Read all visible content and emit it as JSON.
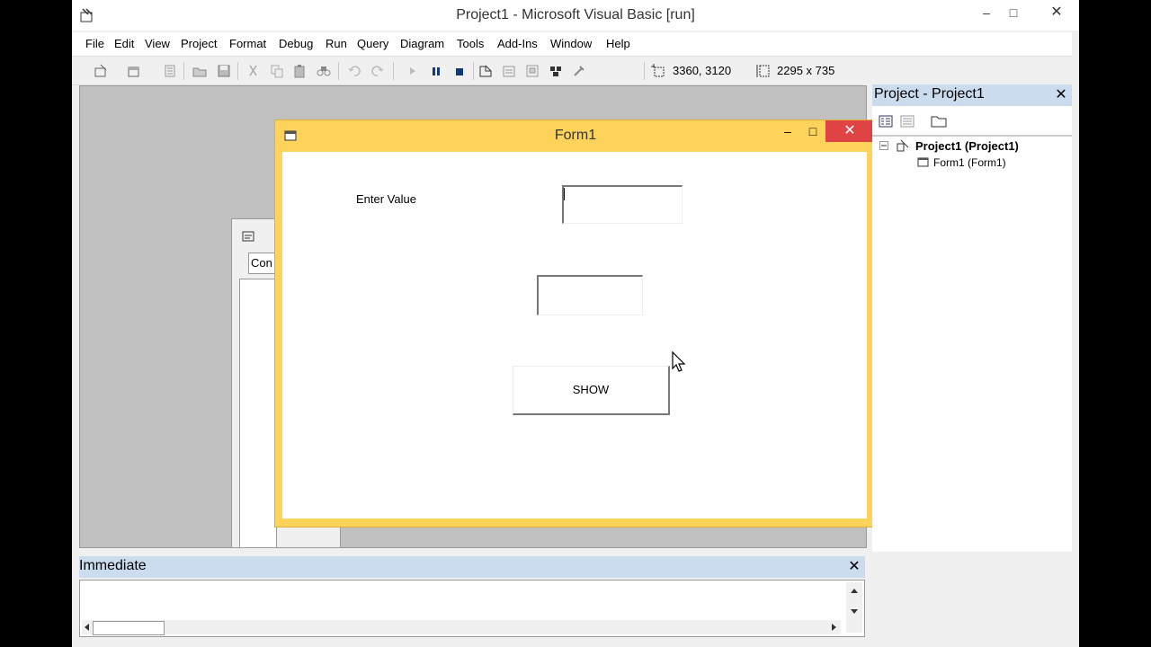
{
  "window": {
    "title": "Project1 - Microsoft Visual Basic [run]",
    "minimize_glyph": "–",
    "maximize_glyph": "□",
    "close_glyph": "✕"
  },
  "menu": [
    "File",
    "Edit",
    "View",
    "Project",
    "Format",
    "Debug",
    "Run",
    "Query",
    "Diagram",
    "Tools",
    "Add-Ins",
    "Window",
    "Help"
  ],
  "toolbar": {
    "position_readout": "3360, 3120",
    "size_readout": "2295 x 735",
    "icons": [
      "add-project-icon",
      "add-form-icon",
      "menu-editor-icon",
      "open-icon",
      "save-icon",
      "cut-icon",
      "copy-icon",
      "paste-icon",
      "find-icon",
      "undo-icon",
      "redo-icon",
      "start-icon",
      "break-icon",
      "end-icon",
      "project-explorer-icon",
      "properties-icon",
      "form-layout-icon",
      "object-browser-icon",
      "toolbox-icon"
    ]
  },
  "code_window": {
    "combo_text": "Con"
  },
  "form1": {
    "title": "Form1",
    "label": "Enter Value",
    "text1_value": "",
    "text2_value": "",
    "button_label": "SHOW",
    "minimize_glyph": "–",
    "maximize_glyph": "□",
    "close_glyph": "✕"
  },
  "project_panel": {
    "title": "Project - Project1",
    "close_glyph": "✕",
    "root": "Project1 (Project1)",
    "child": "Form1 (Form1)"
  },
  "immediate": {
    "title": "Immediate",
    "close_glyph": "✕"
  },
  "colors": {
    "form_frame": "#fdd35b",
    "close_red": "#e04343",
    "panel_header": "#cbdcee"
  }
}
